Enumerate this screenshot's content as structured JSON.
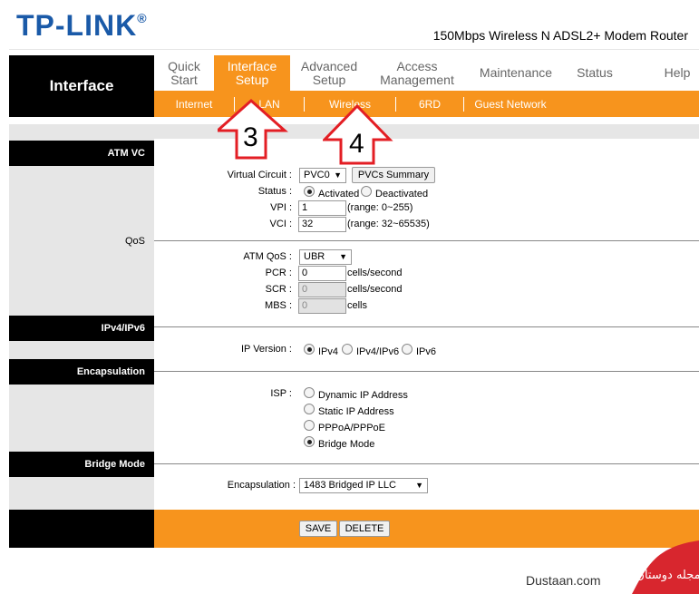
{
  "header": {
    "logo_text": "TP-LINK",
    "logo_reg": "®",
    "model": "150Mbps Wireless N ADSL2+ Modem Router"
  },
  "nav": {
    "section_title": "Interface",
    "tabs": [
      {
        "label": "Quick\nStart"
      },
      {
        "label": "Interface\nSetup"
      },
      {
        "label": "Advanced\nSetup"
      },
      {
        "label": "Access\nManagement"
      },
      {
        "label": "Maintenance"
      },
      {
        "label": "Status"
      },
      {
        "label": "Help"
      }
    ],
    "subtabs": [
      {
        "label": "Internet"
      },
      {
        "label": "LAN"
      },
      {
        "label": "Wireless"
      },
      {
        "label": "6RD"
      },
      {
        "label": "Guest Network"
      }
    ]
  },
  "sections": {
    "atm_vc": "ATM VC",
    "qos": "QoS",
    "ipv4_ipv6": "IPv4/IPv6",
    "encapsulation": "Encapsulation",
    "bridge_mode": "Bridge Mode"
  },
  "form": {
    "virtual_circuit_label": "Virtual Circuit :",
    "virtual_circuit_value": "PVC0",
    "pvcs_summary_button": "PVCs Summary",
    "status_label": "Status :",
    "status_activated": "Activated",
    "status_deactivated": "Deactivated",
    "vpi_label": "VPI :",
    "vpi_value": "1",
    "vpi_range": "(range: 0~255)",
    "vci_label": "VCI :",
    "vci_value": "32",
    "vci_range": "(range: 32~65535)",
    "atm_qos_label": "ATM QoS :",
    "atm_qos_value": "UBR",
    "pcr_label": "PCR :",
    "pcr_value": "0",
    "pcr_unit": "cells/second",
    "scr_label": "SCR :",
    "scr_value": "0",
    "scr_unit": "cells/second",
    "mbs_label": "MBS :",
    "mbs_value": "0",
    "mbs_unit": "cells",
    "ip_version_label": "IP Version :",
    "ip_version_options": [
      "IPv4",
      "IPv4/IPv6",
      "IPv6"
    ],
    "isp_label": "ISP :",
    "isp_options": [
      "Dynamic IP Address",
      "Static IP Address",
      "PPPoA/PPPoE",
      "Bridge Mode"
    ],
    "encap_label": "Encapsulation :",
    "encap_value": "1483 Bridged IP LLC"
  },
  "footer": {
    "save_button": "SAVE",
    "delete_button": "DELETE"
  },
  "annotations": {
    "arrow_3": "3",
    "arrow_4": "4"
  },
  "watermark": {
    "site": "Dustaan.com",
    "logo_text": "مجله دوستان"
  },
  "colors": {
    "brand_blue": "#1a5aa8",
    "accent_orange": "#f7941d",
    "arrow_red": "#e31e24"
  }
}
